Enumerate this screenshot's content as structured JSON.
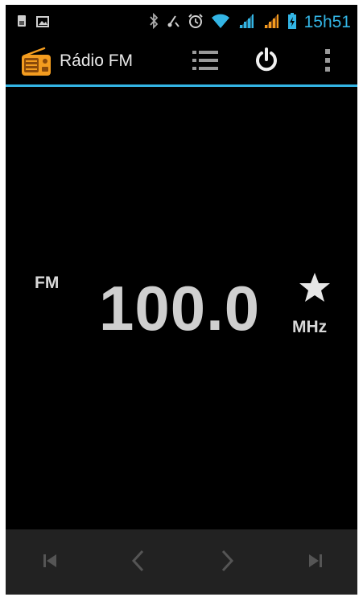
{
  "status_bar": {
    "time": "15h51",
    "icons": [
      "sim-card-icon",
      "image-icon",
      "bluetooth-icon",
      "headset-off-icon",
      "alarm-icon",
      "wifi-icon",
      "signal-icon",
      "signal-orange-icon",
      "battery-icon"
    ]
  },
  "action_bar": {
    "title": "Rádio FM",
    "icon": "radio-icon",
    "actions": [
      "channel-list-icon",
      "power-icon",
      "overflow-menu-icon"
    ]
  },
  "tuner": {
    "band": "FM",
    "frequency": "100.0",
    "unit": "MHz",
    "favorite_icon": "star-icon"
  },
  "bottom_nav": {
    "buttons": [
      "skip-first-icon",
      "chevron-left-icon",
      "chevron-right-icon",
      "skip-last-icon"
    ]
  },
  "colors": {
    "accent": "#33b5e5",
    "background": "#000000",
    "bottom_bar": "#222222",
    "radio_icon": "#f39c1f"
  }
}
